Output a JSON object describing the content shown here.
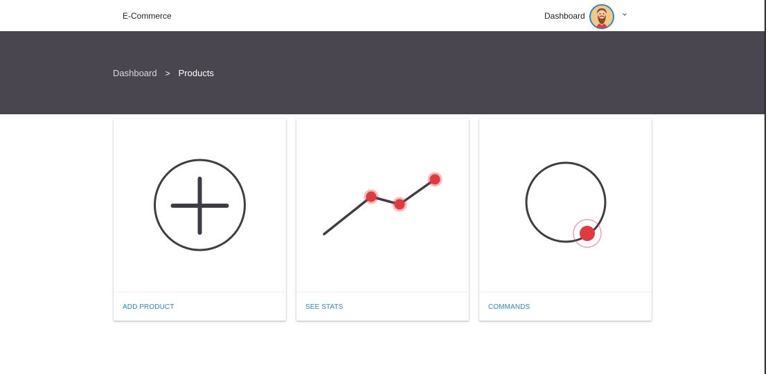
{
  "header": {
    "brand": "E-Commerce",
    "nav_dashboard": "Dashboard",
    "avatar_icon": "bearded-man-avatar-icon",
    "menu_icon": "chevron-down-icon"
  },
  "breadcrumb": {
    "items": [
      "Dashboard",
      "Products"
    ],
    "separator": ">"
  },
  "cards": [
    {
      "action_label": "ADD PRODUCT",
      "icon": "plus-circle-icon"
    },
    {
      "action_label": "SEE STATS",
      "icon": "line-chart-icon"
    },
    {
      "action_label": "COMMANDS",
      "icon": "circle-progress-icon"
    }
  ],
  "colors": {
    "hero_background": "#4a4650",
    "icon_stroke": "#3f3c44",
    "accent_red": "#e0393e",
    "link_blue": "#2a87c9"
  }
}
